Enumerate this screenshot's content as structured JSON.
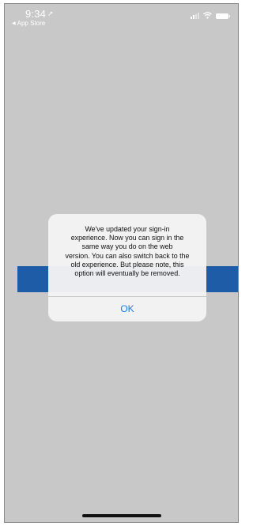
{
  "status_bar": {
    "time": "9:34",
    "location_icon": "location-arrow-icon",
    "back_app": "App Store",
    "back_icon": "back-triangle-icon",
    "signal_icon": "signal-icon",
    "wifi_icon": "wifi-icon",
    "battery_icon": "battery-icon"
  },
  "alert": {
    "message": "We've updated your sign-in\nexperience. Now you can sign in the\nsame way you do on the web\nversion. You can also switch back to the\nold experience. But please note, this\noption will eventually be removed.",
    "ok_label": "OK"
  },
  "colors": {
    "background": "#c8c8c8",
    "blue_bar": "#1f5ca8",
    "alert_button": "#1a7de8"
  }
}
